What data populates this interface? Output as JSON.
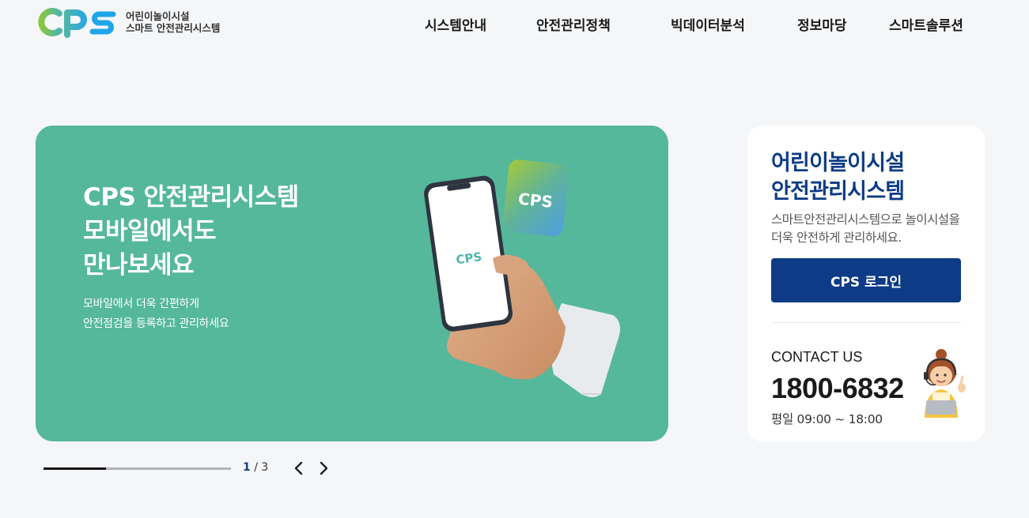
{
  "header": {
    "logo": {
      "mark": "CPS",
      "line1": "어린이놀이시설",
      "line2": "스마트 안전관리시스템"
    },
    "nav": [
      "시스템안내",
      "안전관리정책",
      "빅데이터분석",
      "정보마당",
      "스마트솔루션"
    ]
  },
  "hero": {
    "title_lines": [
      "CPS 안전관리시스템",
      "모바일에서도",
      "만나보세요"
    ],
    "desc_lines": [
      "모바일에서 더욱 간편하게",
      "안전점검을 등록하고 관리하세요"
    ],
    "phone_screen_logo": "CPS",
    "tile_logo": "CPS",
    "background_color": "#55b89a"
  },
  "slider": {
    "current": "1",
    "separator": "/",
    "total": "3",
    "progress_fraction": 0.333
  },
  "card": {
    "title_lines": [
      "어린이놀이시설",
      "안전관리시스템"
    ],
    "description": "스마트안전관리시스템으로 놀이시설을 더욱 안전하게 관리하세요.",
    "login_label": "CPS 로그인",
    "contact_label": "CONTACT US",
    "phone": "1800-6832",
    "hours": "평일 09:00 ~ 18:00"
  },
  "colors": {
    "brand_navy": "#0d3b85",
    "hero_green": "#55b89a",
    "page_bg": "#f5f6f8"
  },
  "icons": {
    "prev": "chevron-left-icon",
    "next": "chevron-right-icon",
    "operator": "headset-operator-illustration"
  }
}
